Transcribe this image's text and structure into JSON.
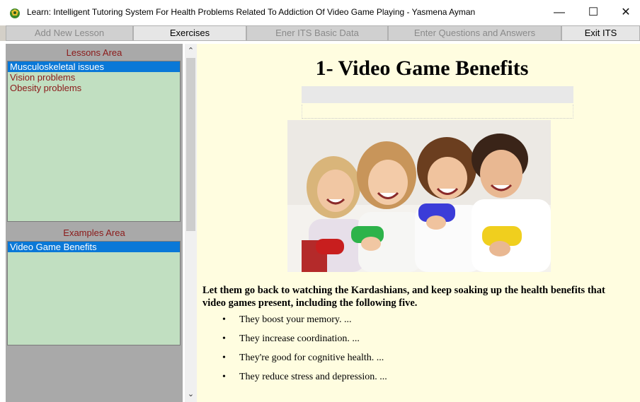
{
  "window": {
    "title": "Learn: Intelligent Tutoring System For Health Problems Related To Addiction Of Video Game Playing  - Yasmena Ayman",
    "minimize_glyph": "—",
    "maximize_glyph": "☐",
    "close_glyph": "✕",
    "icon": "app-logo-icon"
  },
  "toolbar": {
    "add_lesson": "Add New Lesson",
    "exercises": "Exercises",
    "enter_basic_data": "Ener ITS Basic Data",
    "enter_qa": "Enter Questions and Answers",
    "exit": "Exit ITS"
  },
  "lessons": {
    "title": "Lessons  Area",
    "items": [
      "Musculoskeletal issues",
      "Vision problems",
      "Obesity problems"
    ],
    "selected_index": 0
  },
  "examples": {
    "title": "Examples  Area",
    "items": [
      "Video Game Benefits"
    ],
    "selected_index": 0
  },
  "content": {
    "heading": "1- Video Game Benefits",
    "photo_icon": "family-gaming-photo",
    "intro": "Let them go back to watching the Kardashians, and keep soaking up the health benefits that video games present, including the following five.",
    "benefits": [
      "They boost your memory. ...",
      "They increase coordination. ...",
      "They're good for cognitive health. ...",
      "They reduce stress and depression. ..."
    ]
  },
  "scrollbar": {
    "up_glyph": "⌃",
    "down_glyph": "⌄"
  },
  "colors": {
    "list_background": "#c1dfc1",
    "list_text": "#8b1a1a",
    "selection": "#0a78d7",
    "content_background": "#fffde0",
    "panel_background": "#a9a9a9"
  }
}
